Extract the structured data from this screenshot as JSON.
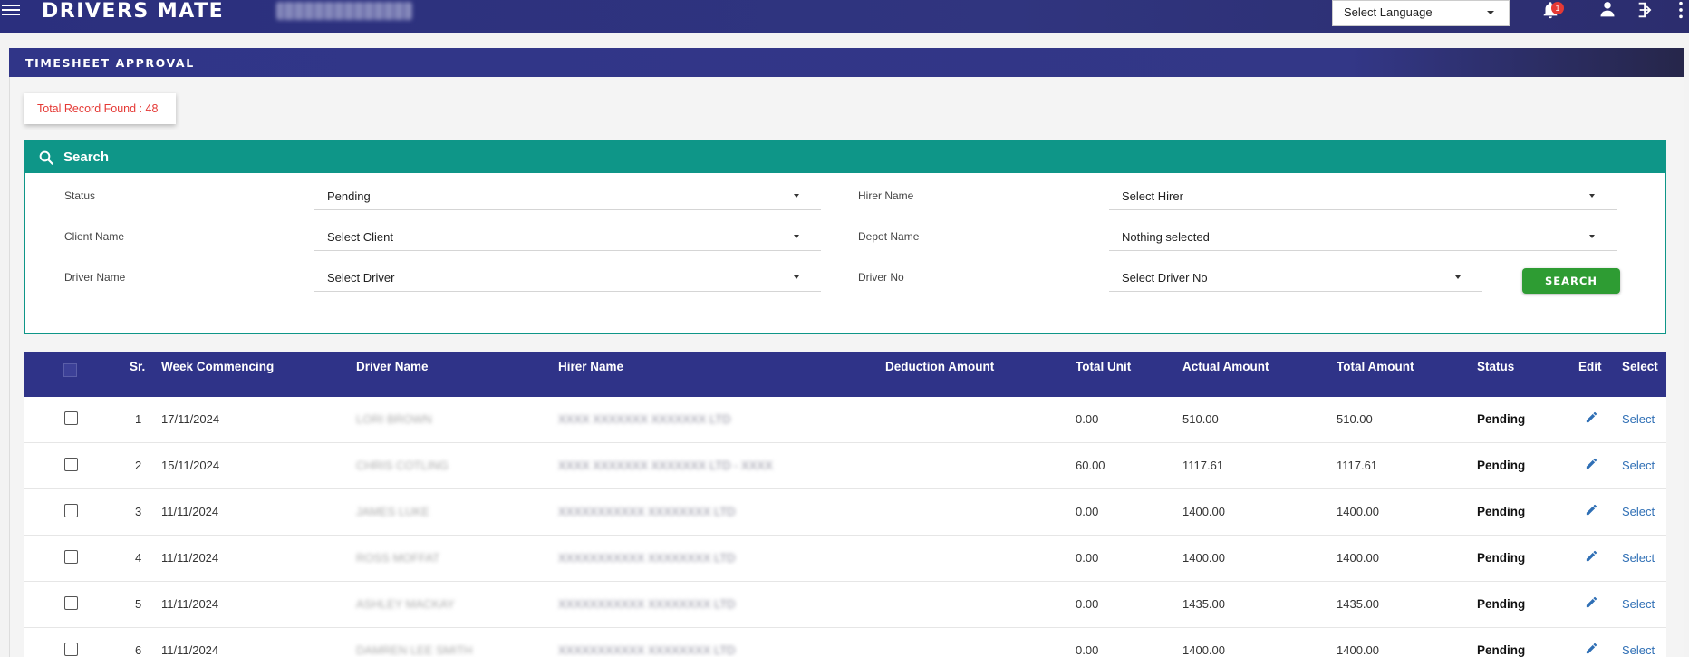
{
  "app": {
    "brand": "DRIVERS MATE",
    "language_select": "Select Language",
    "notification_count": "1"
  },
  "page": {
    "title": "TIMESHEET APPROVAL",
    "record_count": "Total Record Found : 48"
  },
  "search": {
    "title": "Search",
    "fields": {
      "status_label": "Status",
      "status_value": "Pending",
      "hirer_label": "Hirer Name",
      "hirer_value": "Select Hirer",
      "client_label": "Client Name",
      "client_value": "Select Client",
      "depot_label": "Depot Name",
      "depot_value": "Nothing selected",
      "driver_label": "Driver Name",
      "driver_value": "Select Driver",
      "driver_no_label": "Driver No",
      "driver_no_value": "Select Driver No"
    },
    "button": "SEARCH"
  },
  "table": {
    "headers": {
      "sr": "Sr.",
      "week": "Week Commencing",
      "driver": "Driver Name",
      "hirer": "Hirer Name",
      "deduction": "Deduction Amount",
      "unit": "Total Unit",
      "actual": "Actual Amount",
      "total": "Total Amount",
      "status": "Status",
      "edit": "Edit",
      "select": "Select"
    },
    "rows": [
      {
        "sr": "1",
        "week": "17/11/2024",
        "driver": "LORI BROWN",
        "hirer": "XXXX XXXXXXX XXXXXXX LTD",
        "deduction": "",
        "unit": "0.00",
        "actual": "510.00",
        "total": "510.00",
        "status": "Pending",
        "select": "Select"
      },
      {
        "sr": "2",
        "week": "15/11/2024",
        "driver": "CHRIS COTLING",
        "hirer": "XXXX XXXXXXX XXXXXXX LTD - XXXX",
        "deduction": "",
        "unit": "60.00",
        "actual": "1117.61",
        "total": "1117.61",
        "status": "Pending",
        "select": "Select"
      },
      {
        "sr": "3",
        "week": "11/11/2024",
        "driver": "JAMES LUKE",
        "hirer": "XXXXXXXXXXX XXXXXXXX LTD",
        "deduction": "",
        "unit": "0.00",
        "actual": "1400.00",
        "total": "1400.00",
        "status": "Pending",
        "select": "Select"
      },
      {
        "sr": "4",
        "week": "11/11/2024",
        "driver": "ROSS MOFFAT",
        "hirer": "XXXXXXXXXXX XXXXXXXX LTD",
        "deduction": "",
        "unit": "0.00",
        "actual": "1400.00",
        "total": "1400.00",
        "status": "Pending",
        "select": "Select"
      },
      {
        "sr": "5",
        "week": "11/11/2024",
        "driver": "ASHLEY MACKAY",
        "hirer": "XXXXXXXXXXX XXXXXXXX LTD",
        "deduction": "",
        "unit": "0.00",
        "actual": "1435.00",
        "total": "1435.00",
        "status": "Pending",
        "select": "Select"
      },
      {
        "sr": "6",
        "week": "11/11/2024",
        "driver": "DAMREN LEE SMITH",
        "hirer": "XXXXXXXXXXX XXXXXXXX LTD",
        "deduction": "",
        "unit": "0.00",
        "actual": "1400.00",
        "total": "1400.00",
        "status": "Pending",
        "select": "Select"
      }
    ]
  },
  "colors": {
    "nav": "#2b2f7e",
    "search_header": "#0e9688",
    "search_button": "#2e9c33",
    "record_text": "#e53935",
    "link": "#2f6fb5"
  },
  "icons": [
    "menu-icon",
    "bell-icon",
    "user-icon",
    "logout-icon",
    "more-vertical-icon",
    "search-icon",
    "pencil-icon"
  ]
}
